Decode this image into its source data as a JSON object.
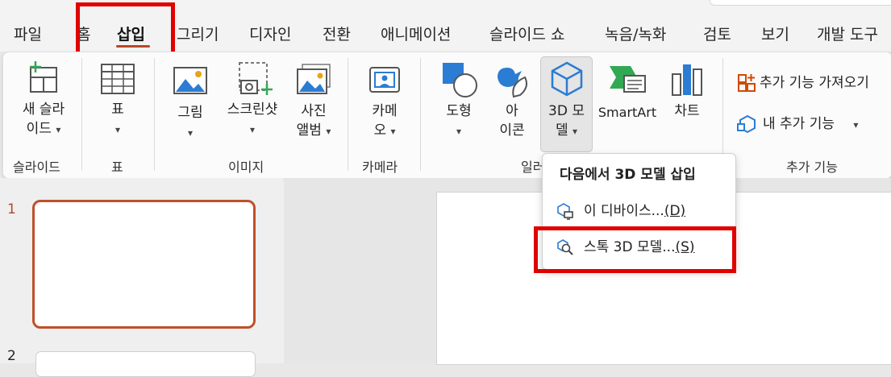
{
  "tabs": [
    {
      "label": "파일"
    },
    {
      "label": "홈"
    },
    {
      "label": "삽입"
    },
    {
      "label": "그리기"
    },
    {
      "label": "디자인"
    },
    {
      "label": "전환"
    },
    {
      "label": "애니메이션"
    },
    {
      "label": "슬라이드 쇼"
    },
    {
      "label": "녹음/녹화"
    },
    {
      "label": "검토"
    },
    {
      "label": "보기"
    },
    {
      "label": "개발 도구"
    }
  ],
  "ribbon": {
    "new_slide": {
      "line1": "새 슬라",
      "line2": "이드"
    },
    "table": {
      "label": "표"
    },
    "picture": {
      "label": "그림"
    },
    "screenshot": {
      "label": "스크린샷"
    },
    "photo_album": {
      "line1": "사진",
      "line2": "앨범"
    },
    "camera": {
      "line1": "카메",
      "line2": "오"
    },
    "shapes": {
      "label": "도형"
    },
    "icons": {
      "line1": "아",
      "line2": "이콘"
    },
    "model3d": {
      "line1": "3D 모",
      "line2": "델"
    },
    "smartart": {
      "label": "SmartArt"
    },
    "chart": {
      "label": "차트"
    },
    "get_addins": {
      "label": "추가 기능 가져오기"
    },
    "my_addins": {
      "label": "내 추가 기능"
    },
    "groups": {
      "slides": "슬라이드",
      "table": "표",
      "images": "이미지",
      "camera": "카메라",
      "illustrations": "일러",
      "addins": "추가 기능"
    }
  },
  "dropdown": {
    "title": "다음에서 3D 모델 삽입",
    "items": [
      {
        "label": "이 디바이스...",
        "key": "(D)"
      },
      {
        "label": "스톡 3D 모델...",
        "key": "(S)"
      }
    ]
  },
  "slides": [
    {
      "number": "1"
    },
    {
      "number": "2"
    }
  ],
  "colors": {
    "accent": "#b7472a",
    "highlight": "#e00000",
    "icon_blue": "#2b7cd3",
    "icon_green": "#33a852"
  }
}
